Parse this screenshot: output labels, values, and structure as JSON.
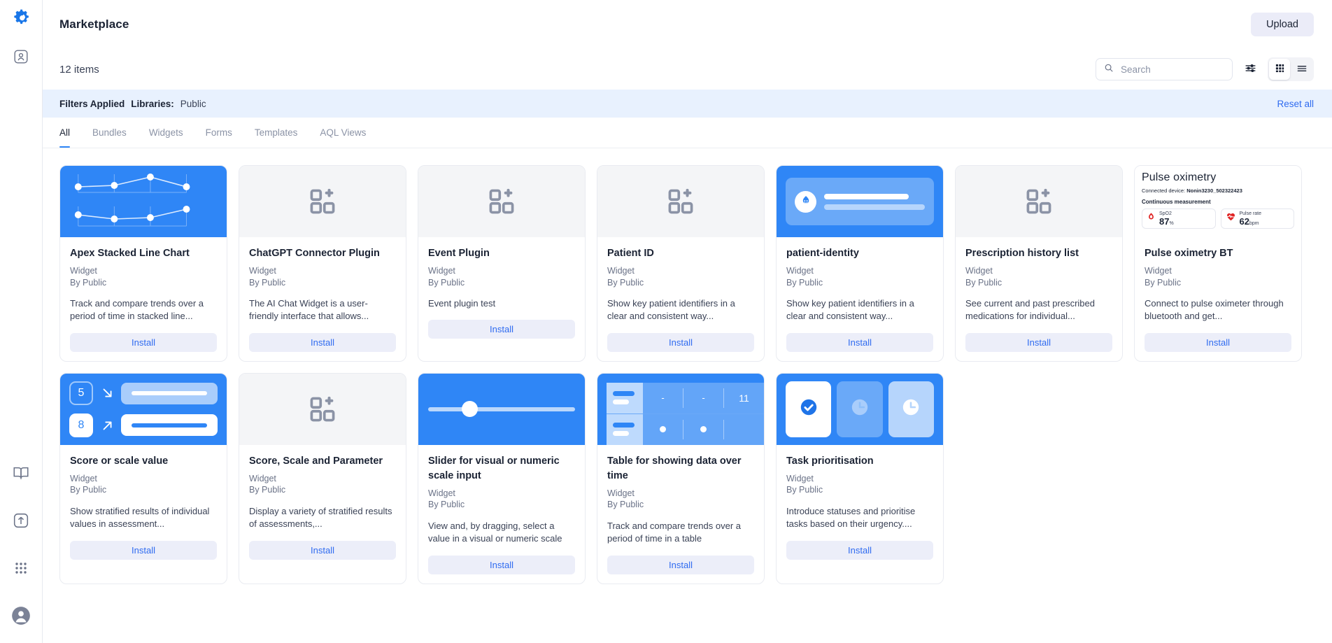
{
  "rail": {
    "logo_icon": "gear-logo-icon",
    "items": [
      {
        "name": "person-box-icon"
      },
      {
        "name": "book-icon"
      },
      {
        "name": "upload-box-icon"
      },
      {
        "name": "apps-grid-icon"
      },
      {
        "name": "avatar-icon"
      }
    ]
  },
  "header": {
    "title": "Marketplace",
    "upload_label": "Upload"
  },
  "subbar": {
    "items_count": "12 items",
    "search_placeholder": "Search",
    "search_value": "",
    "filter_icon": "sliders-icon",
    "grid_view_icon": "grid-view-icon",
    "list_view_icon": "list-view-icon",
    "active_view": "grid"
  },
  "filterbar": {
    "label": "Filters Applied",
    "facet_label": "Libraries:",
    "facet_value": "Public",
    "reset_label": "Reset all",
    "accent": "#2f6bf0",
    "background": "#e8f1fe"
  },
  "tabs": [
    {
      "label": "All",
      "active": true
    },
    {
      "label": "Bundles",
      "active": false
    },
    {
      "label": "Widgets",
      "active": false
    },
    {
      "label": "Forms",
      "active": false
    },
    {
      "label": "Templates",
      "active": false
    },
    {
      "label": "AQL Views",
      "active": false
    }
  ],
  "install_label": "Install",
  "colors": {
    "primary_blue": "#2f86f6",
    "link_blue": "#2f6bf0",
    "install_bg": "#eceef9",
    "thumb_grey": "#f4f5f7"
  },
  "oximetry_preview": {
    "title": "Pulse oximetry",
    "device_label": "Connected device:",
    "device_value": "Nonin3230_502322423",
    "measurement_label": "Continuous measurement",
    "tiles": [
      {
        "label": "SpO2",
        "value": "87",
        "unit": "%",
        "icon": "blood-drop-icon"
      },
      {
        "label": "Pulse rate",
        "value": "62",
        "unit": "bpm",
        "icon": "heart-pulse-icon"
      }
    ]
  },
  "table_preview": {
    "row1": [
      "-",
      "-",
      "11"
    ],
    "row2": [
      "dot",
      "dot",
      ""
    ]
  },
  "score_preview": {
    "value_a": "5",
    "value_b": "8"
  },
  "cards": [
    {
      "title": "Apex Stacked Line Chart",
      "kind": "Widget",
      "author": "By Public",
      "desc": "Track and compare trends over a period of time in stacked line...",
      "thumb": "chart"
    },
    {
      "title": "ChatGPT Connector Plugin",
      "kind": "Widget",
      "author": "By Public",
      "desc": "The AI Chat Widget is a user-friendly interface that allows...",
      "thumb": "placeholder"
    },
    {
      "title": "Event Plugin",
      "kind": "Widget",
      "author": "By Public",
      "desc": "Event plugin test",
      "thumb": "placeholder"
    },
    {
      "title": "Patient ID",
      "kind": "Widget",
      "author": "By Public",
      "desc": "Show key patient identifiers in a clear and consistent way...",
      "thumb": "placeholder"
    },
    {
      "title": "patient-identity",
      "kind": "Widget",
      "author": "By Public",
      "desc": "Show key patient identifiers in a clear and consistent way...",
      "thumb": "identity"
    },
    {
      "title": "Prescription history list",
      "kind": "Widget",
      "author": "By Public",
      "desc": "See current and past prescribed medications for individual...",
      "thumb": "placeholder"
    },
    {
      "title": "Pulse oximetry BT",
      "kind": "Widget",
      "author": "By Public",
      "desc": "Connect to pulse oximeter through bluetooth and get...",
      "thumb": "oximetry"
    },
    {
      "title": "Score or scale value",
      "kind": "Widget",
      "author": "By Public",
      "desc": "Show stratified results of individual values in assessment...",
      "thumb": "score"
    },
    {
      "title": "Score, Scale and Parameter",
      "kind": "Widget",
      "author": "By Public",
      "desc": "Display a variety of stratified results of assessments,...",
      "thumb": "placeholder"
    },
    {
      "title": "Slider for visual or numeric scale input",
      "kind": "Widget",
      "author": "By Public",
      "desc": "View and, by dragging, select a value in a visual or numeric scale",
      "thumb": "slider"
    },
    {
      "title": "Table for showing data over time",
      "kind": "Widget",
      "author": "By Public",
      "desc": "Track and compare trends over a period of time in a table",
      "thumb": "table"
    },
    {
      "title": "Task prioritisation",
      "kind": "Widget",
      "author": "By Public",
      "desc": "Introduce statuses and prioritise tasks based on their urgency....",
      "thumb": "task"
    }
  ]
}
